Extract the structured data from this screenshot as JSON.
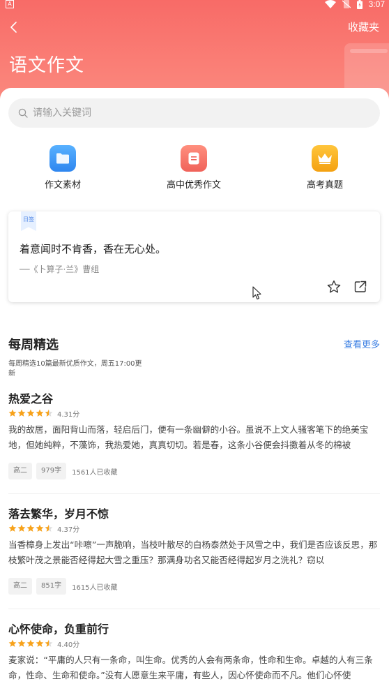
{
  "status_bar": {
    "time": "3:07",
    "notification_icon": "A"
  },
  "header": {
    "title": "语文作文",
    "favorites": "收藏夹"
  },
  "search": {
    "placeholder": "请输入关键词"
  },
  "quick_links": [
    {
      "label": "作文素材",
      "color": "#3f9af5"
    },
    {
      "label": "高中优秀作文",
      "color": "#f7766a"
    },
    {
      "label": "高考真题",
      "color": "#f7b42b"
    }
  ],
  "daily_quote": {
    "badge": "日签",
    "text": "着意闻时不肯香，香在无心处。",
    "source": "──《卜算子·兰》曹组"
  },
  "weekly": {
    "title": "每周精选",
    "see_more": "查看更多",
    "subtitle": "每周精选10篇最新优质作文，周五17:00更新"
  },
  "articles": [
    {
      "title": "热爱之谷",
      "stars": 4.5,
      "score": "4.31分",
      "excerpt": "我的故居，面阳背山而落，轻启后门，便有一条幽僻的小谷。虽说不上文人骚客笔下的绝美宝地，但她纯粹，不藻饰，我热爱她，真真切切。若是春，这条小谷便会抖擞着从冬的棉被",
      "grade": "高二",
      "words": "979字",
      "favorites": "1561人已收藏"
    },
    {
      "title": "落去繁华，岁月不惊",
      "stars": 4.5,
      "score": "4.37分",
      "excerpt": "当香樟身上发出“咔嚓”一声脆响，当枝叶散尽的白杨泰然处于风雪之中，我们是否应该反思，那枝繁叶茂之景能否经得起大雪之重压？那满身功名又能否经得起岁月之洗礼？窃以",
      "grade": "高二",
      "words": "851字",
      "favorites": "1615人已收藏"
    },
    {
      "title": "心怀使命，负重前行",
      "stars": 4.5,
      "score": "4.40分",
      "excerpt": "麦家说：“平庸的人只有一条命，叫生命。优秀的人会有两条命，性命和生命。卓越的人有三条命，性命、生命和使命。”没有人愿意生来平庸，有些人，因心怀使命而不凡。他们心怀使",
      "grade": "",
      "words": "",
      "favorites": ""
    }
  ],
  "colors": {
    "header_top": "#f86b67",
    "header_bottom": "#fb8a7f",
    "accent_link": "#3b7fe3",
    "star": "#f7a21b"
  }
}
